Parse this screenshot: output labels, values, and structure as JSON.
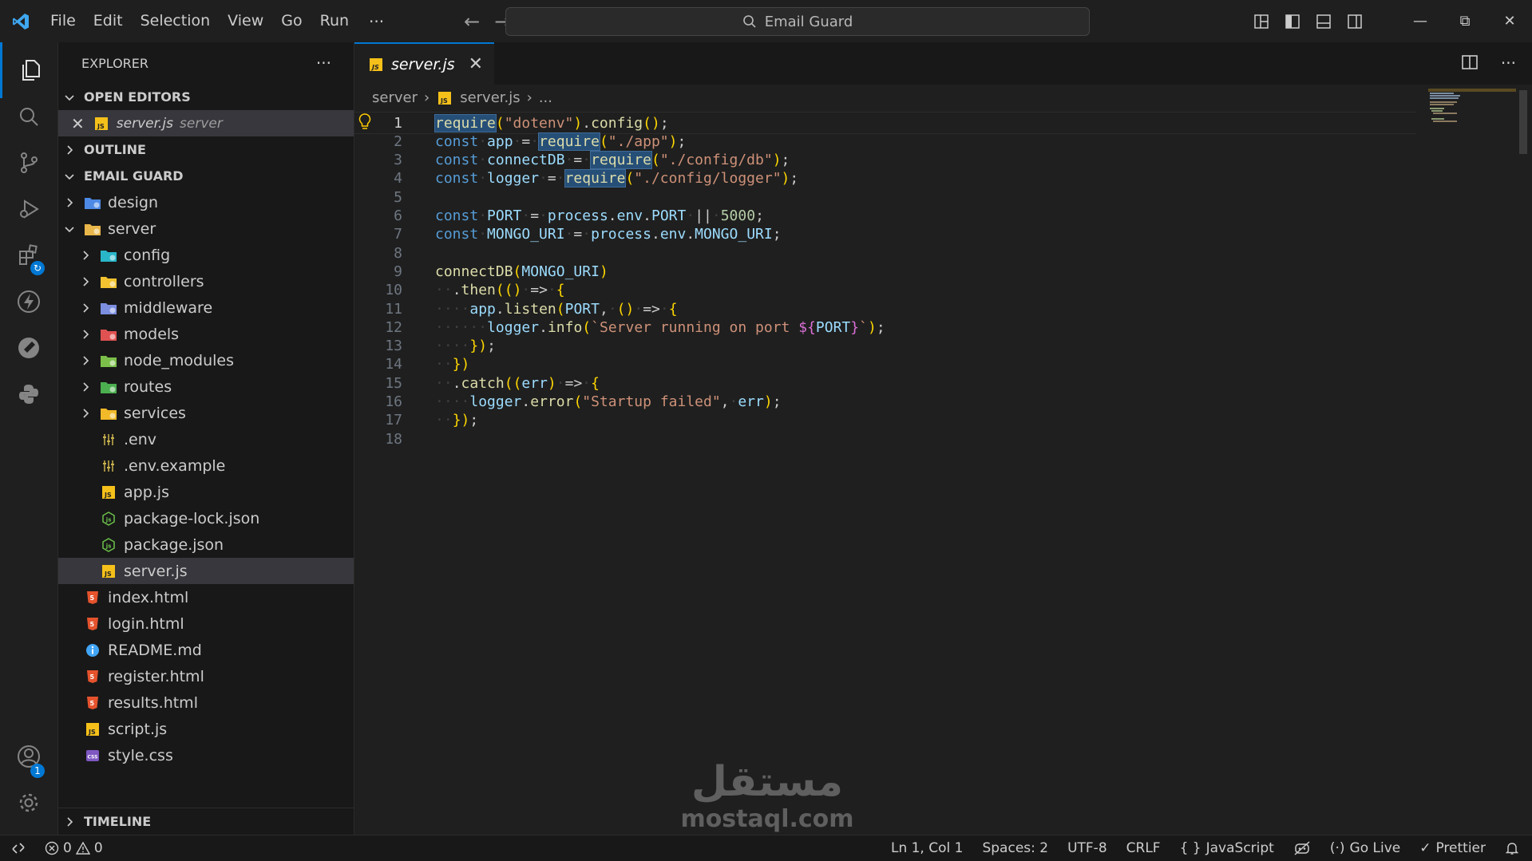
{
  "menu": [
    "File",
    "Edit",
    "Selection",
    "View",
    "Go",
    "Run"
  ],
  "menu_more": "···",
  "command_center": "Email Guard",
  "explorer": {
    "title": "EXPLORER",
    "more": "···",
    "open_editors_title": "OPEN EDITORS",
    "open_editor": {
      "name": "server.js",
      "desc": "server"
    },
    "outline_title": "OUTLINE",
    "project_title": "EMAIL GUARD",
    "timeline_title": "TIMELINE",
    "tree": [
      {
        "name": "design",
        "kind": "folder",
        "depth": 0,
        "icon_color": "#4d8ae6"
      },
      {
        "name": "server",
        "kind": "folder-open",
        "depth": 0,
        "icon_color": "#e8b64a"
      },
      {
        "name": "config",
        "kind": "folder",
        "depth": 1,
        "icon_color": "#29b6c9"
      },
      {
        "name": "controllers",
        "kind": "folder",
        "depth": 1,
        "icon_color": "#f2c230"
      },
      {
        "name": "middleware",
        "kind": "folder",
        "depth": 1,
        "icon_color": "#7c8ee0"
      },
      {
        "name": "models",
        "kind": "folder",
        "depth": 1,
        "icon_color": "#e05252"
      },
      {
        "name": "node_modules",
        "kind": "folder",
        "depth": 1,
        "icon_color": "#7bbf4a"
      },
      {
        "name": "routes",
        "kind": "folder",
        "depth": 1,
        "icon_color": "#4caf50"
      },
      {
        "name": "services",
        "kind": "folder",
        "depth": 1,
        "icon_color": "#f2b928"
      },
      {
        "name": ".env",
        "kind": "env",
        "depth": 1
      },
      {
        "name": ".env.example",
        "kind": "env",
        "depth": 1
      },
      {
        "name": "app.js",
        "kind": "js",
        "depth": 1
      },
      {
        "name": "package-lock.json",
        "kind": "pkg",
        "depth": 1
      },
      {
        "name": "package.json",
        "kind": "pkg",
        "depth": 1
      },
      {
        "name": "server.js",
        "kind": "js",
        "depth": 1,
        "selected": true
      },
      {
        "name": "index.html",
        "kind": "html",
        "depth": 0
      },
      {
        "name": "login.html",
        "kind": "html",
        "depth": 0
      },
      {
        "name": "README.md",
        "kind": "info",
        "depth": 0
      },
      {
        "name": "register.html",
        "kind": "html",
        "depth": 0
      },
      {
        "name": "results.html",
        "kind": "html",
        "depth": 0
      },
      {
        "name": "script.js",
        "kind": "js",
        "depth": 0
      },
      {
        "name": "style.css",
        "kind": "css",
        "depth": 0
      }
    ]
  },
  "tab": {
    "name": "server.js"
  },
  "breadcrumb": {
    "folder": "server",
    "file": "server.js",
    "rest": "..."
  },
  "code_lines": [
    "require(\"dotenv\").config();",
    "const app = require(\"./app\");",
    "const connectDB = require(\"./config/db\");",
    "const logger = require(\"./config/logger\");",
    "",
    "const PORT = process.env.PORT || 5000;",
    "const MONGO_URI = process.env.MONGO_URI;",
    "",
    "connectDB(MONGO_URI)",
    "  .then(() => {",
    "    app.listen(PORT, () => {",
    "      logger.info(`Server running on port ${PORT}`);",
    "    });",
    "  })",
    "  .catch((err) => {",
    "    logger.error(\"Startup failed\", err);",
    "  });",
    ""
  ],
  "status": {
    "errors": "0",
    "warnings": "0",
    "position": "Ln 1, Col 1",
    "spaces": "Spaces: 2",
    "encoding": "UTF-8",
    "eol": "CRLF",
    "language": "JavaScript",
    "golive": "Go Live",
    "prettier": "Prettier"
  },
  "accounts_badge": "1",
  "watermark": {
    "arabic": "مستقل",
    "latin": "mostaql.com"
  },
  "colors": {
    "accent": "#0078d4",
    "editor_bg": "#1f1f1f",
    "sidebar_bg": "#181818",
    "selection": "#37373d"
  }
}
